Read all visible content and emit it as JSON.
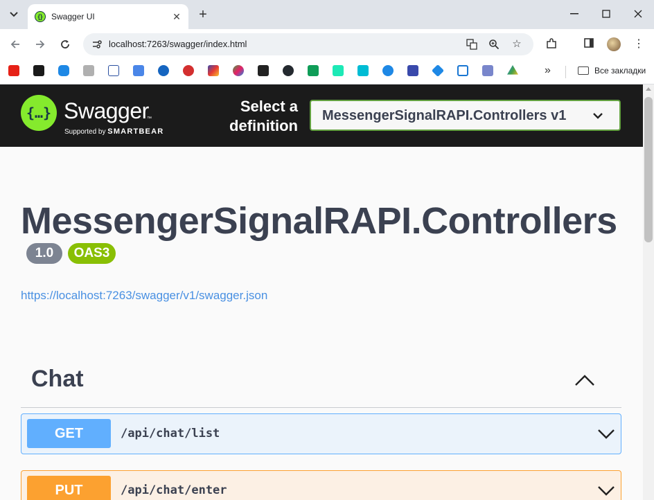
{
  "browser": {
    "tab_title": "Swagger UI",
    "url": "localhost:7263/swagger/index.html",
    "bookmarks_folder": "Все закладки",
    "bookmark_icons": [
      "youtube-icon",
      "chart-icon",
      "chat-icon",
      "disk-icon",
      "pe-ru-icon",
      "translate-icon",
      "cloud-icon",
      "star-badge-icon",
      "puzzle-icon",
      "pinwheel-icon",
      "square-icon",
      "github-icon",
      "plus-square-icon",
      "vector-icon",
      "w-icon",
      "bot-icon",
      "save-icon",
      "diamond-icon",
      "frame-icon",
      "mgu-icon",
      "drive-icon"
    ]
  },
  "swagger": {
    "logo_title": "Swagger",
    "logo_tm": "™",
    "supported_by": "Supported by",
    "smartbear": "SMARTBEAR",
    "select_label_line1": "Select a",
    "select_label_line2": "definition",
    "selected_definition": "MessengerSignalRAPI.Controllers v1"
  },
  "api": {
    "title": "MessengerSignalRAPI.Controllers",
    "version": "1.0",
    "oas": "OAS3",
    "spec_url": "https://localhost:7263/swagger/v1/swagger.json"
  },
  "tag": {
    "name": "Chat"
  },
  "operations": [
    {
      "method": "GET",
      "path": "/api/chat/list",
      "color": "#61affe"
    },
    {
      "method": "PUT",
      "path": "/api/chat/enter",
      "color": "#fca130"
    }
  ],
  "colors": {
    "swagger_green": "#85ea2d",
    "topbar": "#1b1b1b",
    "title_text": "#3b4151",
    "link": "#4990e2"
  }
}
